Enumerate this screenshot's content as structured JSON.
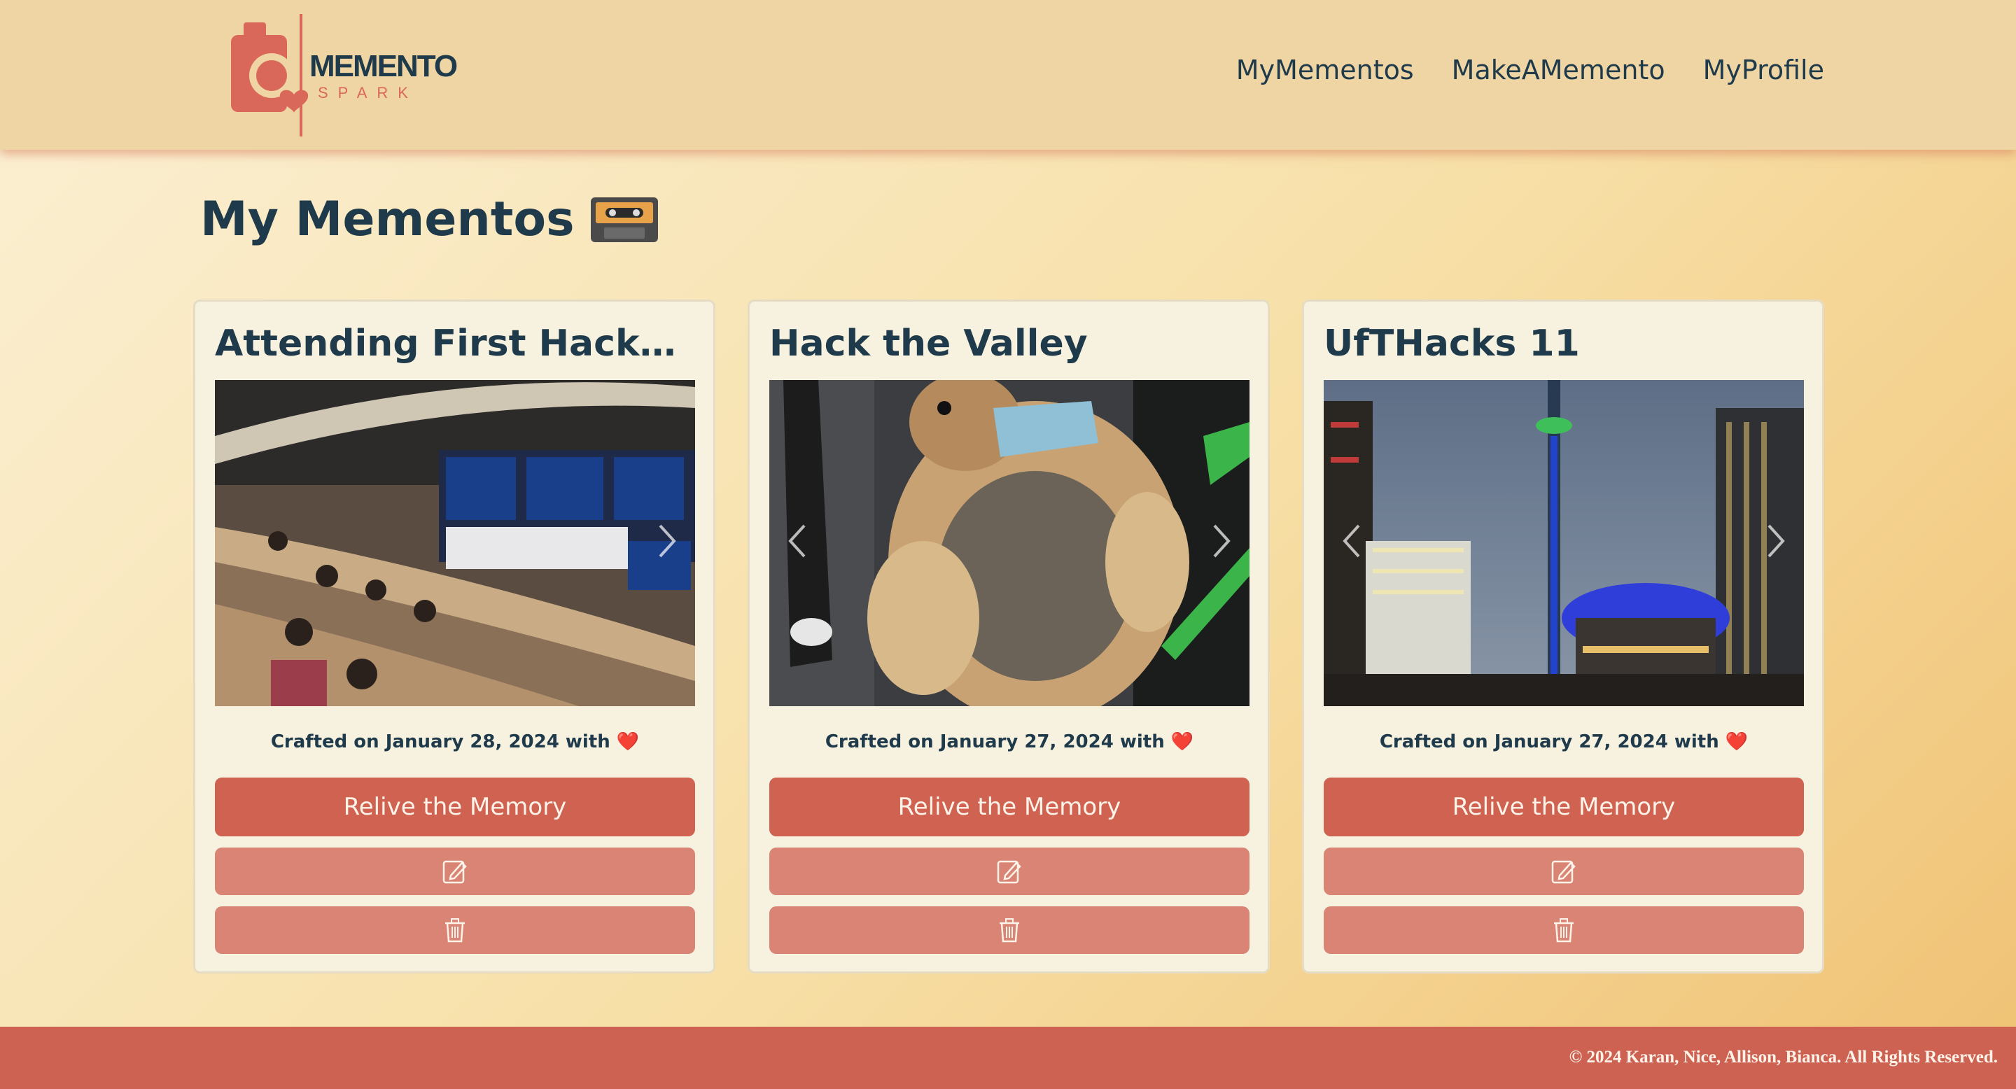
{
  "brand": {
    "name": "MEMENTO",
    "subtitle": "SPARK",
    "logo_icon": "camera-heart-icon",
    "accent": "#cf6250",
    "header_bg": "#efd5a4",
    "text_color": "#1f3a4a"
  },
  "nav": {
    "items": [
      {
        "label": "MyMementos"
      },
      {
        "label": "MakeAMemento"
      },
      {
        "label": "MyProfile"
      }
    ]
  },
  "page": {
    "title": "My Mementos",
    "title_icon": "cassette-tape-icon"
  },
  "cards": [
    {
      "title": "Attending First Hackathon",
      "crafted": "Crafted on January 28, 2024 with",
      "heart": "❤️",
      "relive_label": "Relive the Memory",
      "edit_icon": "edit-icon",
      "delete_icon": "trash-icon",
      "photo_subject": "lecture-hall-photo"
    },
    {
      "title": "Hack the Valley",
      "crafted": "Crafted on January 27, 2024 with",
      "heart": "❤️",
      "relive_label": "Relive the Memory",
      "edit_icon": "edit-icon",
      "delete_icon": "trash-icon",
      "photo_subject": "puppy-photo"
    },
    {
      "title": "UfTHacks 11",
      "crafted": "Crafted on January 27, 2024 with",
      "heart": "❤️",
      "relive_label": "Relive the Memory",
      "edit_icon": "edit-icon",
      "delete_icon": "trash-icon",
      "photo_subject": "city-tower-photo"
    }
  ],
  "footer": {
    "text": "© 2024 Karan, Nice, Allison, Bianca. All Rights Reserved.",
    "bg": "#cd6253"
  }
}
